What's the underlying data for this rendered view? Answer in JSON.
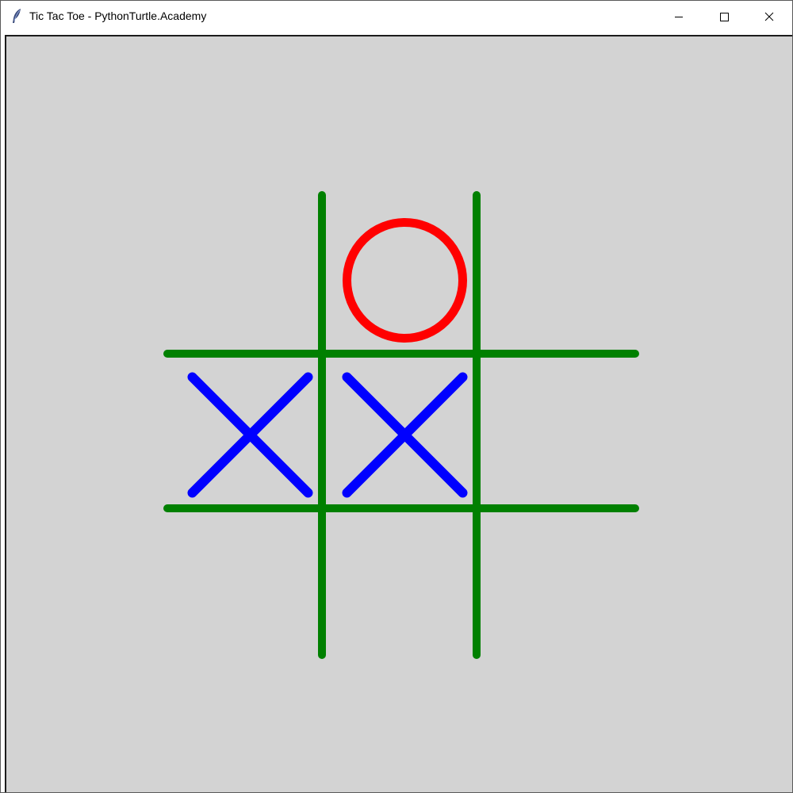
{
  "window": {
    "title": "Tic Tac Toe - PythonTurtle.Academy",
    "icon": "feather-icon",
    "controls": [
      "minimize-icon",
      "maximize-icon",
      "close-icon"
    ]
  },
  "canvas": {
    "background": "#d3d3d3"
  },
  "game": {
    "grid_color": "#008000",
    "x_color": "#0000ff",
    "o_color": "#ff0000",
    "board": [
      [
        "",
        "O",
        ""
      ],
      [
        "X",
        "X",
        ""
      ],
      [
        "",
        "",
        ""
      ]
    ]
  }
}
